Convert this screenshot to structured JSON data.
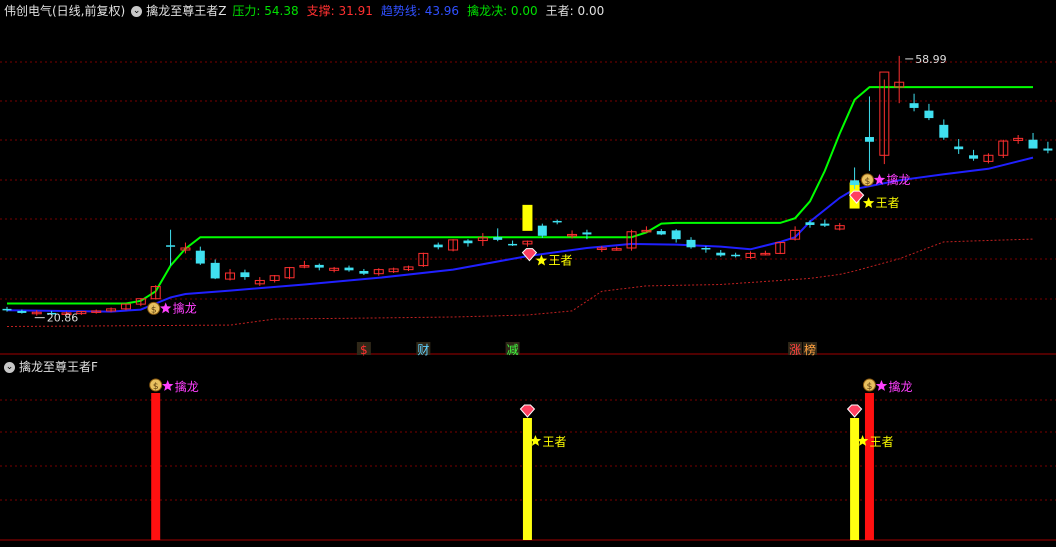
{
  "main_header": {
    "stock": "伟创电气(日线,前复权)",
    "indicator": "擒龙至尊王者Z",
    "items": [
      {
        "label": "压力",
        "value": "54.38",
        "color": "#00e000"
      },
      {
        "label": "支撑",
        "value": "31.91",
        "color": "#ff3030"
      },
      {
        "label": "趋势线",
        "value": "43.96",
        "color": "#3050ff"
      },
      {
        "label": "擒龙决",
        "value": "0.00",
        "color": "#00e000"
      },
      {
        "label": "王者",
        "value": "0.00",
        "color": "#e0e0e0"
      }
    ]
  },
  "sub_header": {
    "indicator": "擒龙至尊王者F"
  },
  "price_labels": {
    "high": "58.99",
    "low": "20.86"
  },
  "signals": {
    "qinlong": "擒龙",
    "wangzhe": "王者"
  },
  "event_markers": [
    "$",
    "财",
    "减",
    "涨",
    "榜"
  ],
  "colors": {
    "up": "#ff3030",
    "down": "#40e0f0",
    "resistance": "#00ff00",
    "trend": "#2020ff",
    "support": "#c02020",
    "yellow": "#ffff00"
  },
  "chart_data": {
    "type": "candlestick",
    "price_range": [
      17,
      64
    ],
    "candles": [
      [
        21.6,
        21.9,
        21.2,
        21.5
      ],
      [
        21.3,
        21.5,
        20.9,
        21.0
      ],
      [
        20.9,
        21.4,
        20.6,
        21.1
      ],
      [
        21.0,
        21.3,
        20.9,
        20.9
      ],
      [
        20.9,
        21.2,
        20.7,
        21.0
      ],
      [
        20.9,
        21.3,
        20.7,
        21.2
      ],
      [
        21.2,
        21.5,
        20.9,
        21.3
      ],
      [
        21.3,
        21.8,
        21.1,
        21.6
      ],
      [
        21.6,
        22.3,
        21.4,
        22.3
      ],
      [
        22.3,
        23.2,
        22.0,
        23.1
      ],
      [
        23.1,
        25.1,
        23.0,
        24.9
      ],
      [
        31.0,
        33.3,
        28.0,
        30.8
      ],
      [
        30.3,
        31.4,
        29.8,
        30.6
      ],
      [
        30.2,
        30.8,
        28.1,
        28.3
      ],
      [
        28.4,
        28.9,
        26.0,
        26.1
      ],
      [
        26.0,
        27.5,
        25.8,
        26.9
      ],
      [
        27.0,
        27.4,
        25.9,
        26.3
      ],
      [
        25.3,
        26.3,
        25.0,
        25.8
      ],
      [
        25.8,
        26.6,
        25.5,
        26.5
      ],
      [
        26.2,
        27.8,
        26.0,
        27.7
      ],
      [
        28.0,
        28.7,
        27.6,
        28.0
      ],
      [
        28.1,
        28.3,
        27.3,
        27.7
      ],
      [
        27.3,
        27.8,
        27.0,
        27.6
      ],
      [
        27.7,
        28.0,
        27.1,
        27.3
      ],
      [
        27.2,
        27.5,
        26.6,
        26.8
      ],
      [
        26.8,
        27.6,
        26.5,
        27.4
      ],
      [
        27.1,
        27.7,
        26.9,
        27.5
      ],
      [
        27.4,
        28.0,
        27.2,
        27.8
      ],
      [
        28.0,
        29.9,
        27.8,
        29.8
      ],
      [
        31.1,
        31.4,
        30.4,
        30.7
      ],
      [
        30.3,
        31.9,
        30.1,
        31.8
      ],
      [
        31.7,
        31.9,
        30.8,
        31.3
      ],
      [
        31.7,
        32.8,
        30.9,
        32.1
      ],
      [
        32.2,
        33.5,
        31.6,
        31.8
      ],
      [
        31.2,
        31.7,
        30.9,
        31.1
      ],
      [
        31.2,
        31.7,
        30.8,
        31.6
      ],
      [
        33.9,
        34.2,
        32.1,
        32.4
      ],
      [
        34.6,
        34.8,
        34.1,
        34.5
      ],
      [
        32.4,
        33.2,
        32.0,
        32.6
      ],
      [
        32.9,
        33.3,
        31.9,
        32.6
      ],
      [
        30.4,
        30.9,
        30.0,
        30.6
      ],
      [
        30.5,
        30.8,
        30.2,
        30.5
      ],
      [
        30.6,
        33.3,
        30.2,
        33.0
      ],
      [
        33.2,
        33.8,
        32.9,
        33.2
      ],
      [
        33.1,
        33.4,
        32.5,
        32.6
      ],
      [
        33.2,
        33.4,
        31.4,
        31.9
      ],
      [
        31.8,
        32.2,
        30.5,
        30.7
      ],
      [
        30.6,
        30.9,
        29.9,
        30.4
      ],
      [
        29.9,
        30.3,
        29.3,
        29.5
      ],
      [
        29.6,
        29.9,
        29.2,
        29.4
      ],
      [
        29.2,
        30.1,
        29.0,
        29.8
      ],
      [
        29.8,
        30.2,
        29.5,
        29.8
      ],
      [
        29.8,
        31.5,
        29.7,
        31.4
      ],
      [
        31.9,
        33.8,
        31.7,
        33.2
      ],
      [
        34.4,
        34.7,
        33.6,
        34.0
      ],
      [
        34.2,
        34.8,
        33.7,
        33.9
      ],
      [
        33.4,
        34.3,
        33.2,
        33.9
      ],
      [
        40.6,
        42.5,
        39.3,
        39.9
      ],
      [
        47.0,
        53.0,
        42.0,
        46.3
      ],
      [
        44.3,
        55.5,
        43.0,
        56.6
      ],
      [
        54.4,
        58.99,
        52.0,
        55.1
      ],
      [
        52.0,
        53.4,
        50.8,
        51.3
      ],
      [
        50.9,
        51.9,
        49.5,
        49.8
      ],
      [
        48.8,
        49.6,
        46.6,
        46.9
      ],
      [
        45.6,
        46.7,
        44.5,
        45.2
      ],
      [
        44.3,
        45.1,
        43.5,
        43.8
      ],
      [
        43.4,
        44.6,
        43.1,
        44.3
      ],
      [
        44.3,
        46.6,
        43.9,
        46.4
      ],
      [
        46.5,
        47.3,
        46.0,
        46.8
      ],
      [
        46.6,
        47.6,
        45.6,
        45.3
      ],
      [
        45.3,
        46.3,
        44.6,
        45.0
      ],
      [
        45.1,
        46.5,
        44.9,
        46.4
      ],
      [
        46.4,
        48.0,
        46.1,
        47.1
      ],
      [
        46.3,
        48.2,
        45.1,
        47.0
      ],
      [
        46.8,
        47.4,
        45.7,
        46.1
      ]
    ],
    "resistance": [
      [
        0,
        22.4
      ],
      [
        8,
        22.4
      ],
      [
        9,
        22.8
      ],
      [
        10,
        24.2
      ],
      [
        11,
        28.0
      ],
      [
        12,
        30.5
      ],
      [
        13,
        32.2
      ],
      [
        42,
        32.2
      ],
      [
        43,
        32.9
      ],
      [
        44,
        34.2
      ],
      [
        45,
        34.3
      ],
      [
        52,
        34.3
      ],
      [
        53,
        35.0
      ],
      [
        54,
        37.5
      ],
      [
        55,
        42.0
      ],
      [
        56,
        47.5
      ],
      [
        57,
        52.5
      ],
      [
        58,
        54.38
      ],
      [
        69,
        54.38
      ]
    ],
    "trend": [
      [
        0,
        21.4
      ],
      [
        7,
        21.2
      ],
      [
        9,
        21.5
      ],
      [
        10,
        22.4
      ],
      [
        11,
        23.3
      ],
      [
        12,
        23.8
      ],
      [
        15,
        24.3
      ],
      [
        20,
        25.2
      ],
      [
        25,
        26.2
      ],
      [
        30,
        27.4
      ],
      [
        35,
        29.4
      ],
      [
        39,
        30.6
      ],
      [
        42,
        31.2
      ],
      [
        45,
        31.1
      ],
      [
        48,
        30.8
      ],
      [
        50,
        30.4
      ],
      [
        52,
        31.5
      ],
      [
        53,
        32.2
      ],
      [
        54,
        34.5
      ],
      [
        56,
        38.0
      ],
      [
        57,
        39.3
      ],
      [
        60,
        40.6
      ],
      [
        63,
        41.5
      ],
      [
        66,
        42.3
      ],
      [
        69,
        43.96
      ]
    ],
    "support": [
      [
        0,
        19.0
      ],
      [
        15,
        19.2
      ],
      [
        18,
        20.1
      ],
      [
        23,
        20.2
      ],
      [
        30,
        20.4
      ],
      [
        35,
        20.7
      ],
      [
        38,
        21.3
      ],
      [
        40,
        24.2
      ],
      [
        43,
        25.0
      ],
      [
        48,
        25.2
      ],
      [
        54,
        26.1
      ],
      [
        56,
        26.7
      ],
      [
        57,
        27.2
      ],
      [
        60,
        29.0
      ],
      [
        63,
        31.5
      ],
      [
        69,
        31.91
      ]
    ],
    "qinlong_signals": [
      10,
      58
    ],
    "wangzhe_signals": [
      35,
      57
    ],
    "yellow_boxes": [
      [
        35,
        33.2,
        35.2
      ],
      [
        57,
        37.0,
        38.5
      ]
    ],
    "event_marker_positions": [
      24,
      28,
      34,
      53,
      54
    ]
  }
}
